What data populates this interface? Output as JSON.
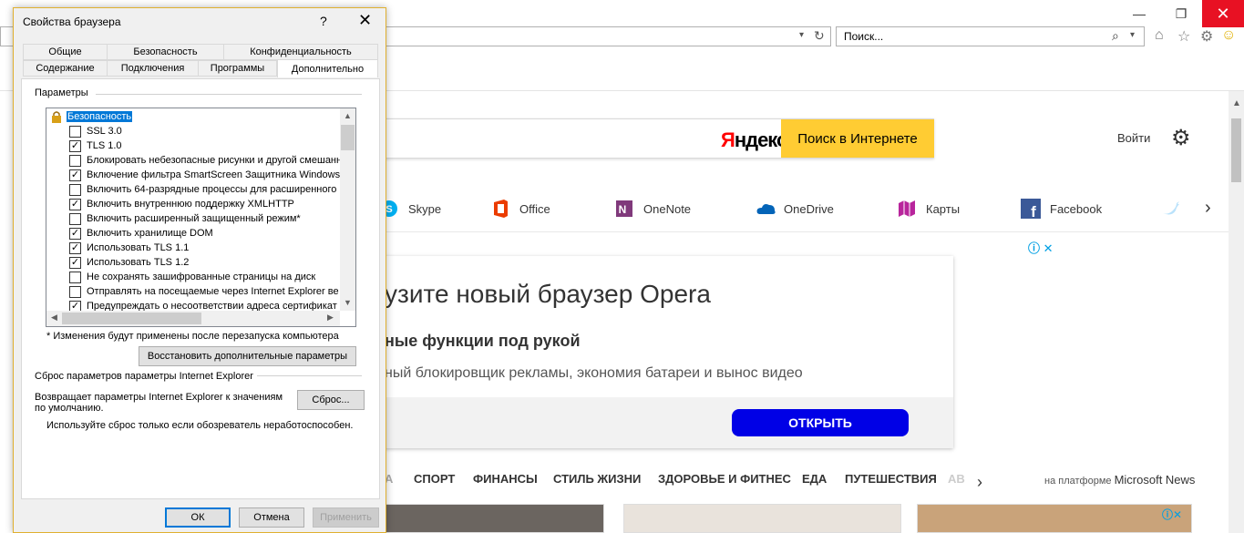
{
  "browser": {
    "search_placeholder": "Поиск...",
    "login_label": "Войти",
    "yandex": {
      "logo_y": "Я",
      "logo_rest": "ндекс",
      "button": "Поиск в Интернете"
    },
    "apps": [
      {
        "name": "Skype",
        "color": "#00aff0"
      },
      {
        "name": "Office",
        "color": "#eb3c00"
      },
      {
        "name": "OneNote",
        "color": "#80397b"
      },
      {
        "name": "OneDrive",
        "color": "#0364b8"
      },
      {
        "name": "Карты",
        "color": "#b8259c"
      },
      {
        "name": "Facebook",
        "color": "#3b5998"
      }
    ],
    "ad": {
      "headline": "узите новый браузер Opera",
      "subheadline": "ные функции под рукой",
      "description": "ный блокировщик рекламы, экономия батареи и вынос видео",
      "cta": "ОТКРЫТЬ",
      "info": "ⓘ ✕"
    },
    "categories": [
      "А",
      "СПОРТ",
      "ФИНАНСЫ",
      "СТИЛЬ ЖИЗНИ",
      "ЗДОРОВЬЕ И ФИТНЕС",
      "ЕДА",
      "ПУТЕШЕСТВИЯ",
      "АВ"
    ],
    "msn": {
      "prefix": "на платформе",
      "brand": "Microsoft News"
    }
  },
  "dialog": {
    "title": "Свойства браузера",
    "help": "?",
    "close": "✕",
    "tabs_top": [
      "Общие",
      "Безопасность",
      "Конфиденциальность"
    ],
    "tabs_bottom": [
      "Содержание",
      "Подключения",
      "Программы",
      "Дополнительно"
    ],
    "active_tab": "Дополнительно",
    "params_label": "Параметры",
    "tree": {
      "group": "Безопасность",
      "items": [
        {
          "label": "SSL 3.0",
          "checked": false
        },
        {
          "label": "TLS 1.0",
          "checked": true
        },
        {
          "label": "Блокировать небезопасные рисунки и другой смешанн",
          "checked": false
        },
        {
          "label": "Включение фильтра SmartScreen Защитника Windows",
          "checked": true
        },
        {
          "label": "Включить 64-разрядные процессы для расширенного",
          "checked": false
        },
        {
          "label": "Включить внутреннюю поддержку XMLHTTP",
          "checked": true
        },
        {
          "label": "Включить расширенный защищенный режим*",
          "checked": false
        },
        {
          "label": "Включить хранилище DOM",
          "checked": true
        },
        {
          "label": "Использовать TLS 1.1",
          "checked": true
        },
        {
          "label": "Использовать TLS 1.2",
          "checked": true
        },
        {
          "label": "Не сохранять зашифрованные страницы на диск",
          "checked": false
        },
        {
          "label": "Отправлять на посещаемые через Internet Explorer ве",
          "checked": false
        },
        {
          "label": "Предупреждать о несоответствии адреса сертификат",
          "checked": true
        }
      ]
    },
    "restart_note": "* Изменения будут применены после перезапуска компьютера",
    "restore_button": "Восстановить дополнительные параметры",
    "reset_group_label": "Сброс параметров параметры Internet Explorer",
    "reset_desc_line1": "Возвращает параметры Internet Explorer к значениям",
    "reset_desc_line2": "по умолчанию.",
    "reset_button": "Сброс...",
    "reset_hint": "Используйте сброс только если обозреватель неработоспособен.",
    "ok": "ОК",
    "cancel": "Отмена",
    "apply": "Применить"
  }
}
